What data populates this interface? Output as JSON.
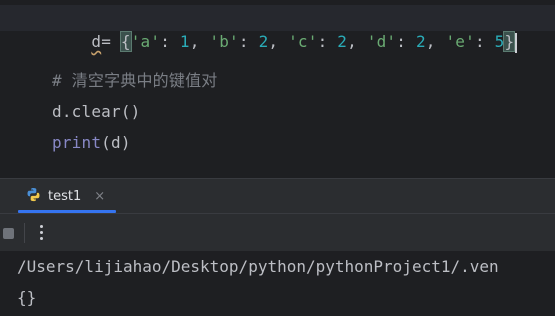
{
  "editor": {
    "line1": {
      "var": "d",
      "op": "= ",
      "open_brace": "{",
      "k1": "'a'",
      "v1": "1",
      "k2": "'b'",
      "v2": "2",
      "k3": "'c'",
      "v3": "2",
      "k4": "'d'",
      "v4": "2",
      "k5": "'e'",
      "v5": "5",
      "close_brace": "}",
      "colon": ": ",
      "comma": ", "
    },
    "comment": "# 清空字典中的键值对",
    "clear_call": "d.clear()",
    "print_fn": "print",
    "print_args": "(d)"
  },
  "run_panel": {
    "tab_label": "test1",
    "close_glyph": "×"
  },
  "console": {
    "path_line": "/Users/lijiahao/Desktop/python/pythonProject1/.ven",
    "output": "{}"
  },
  "colors": {
    "background": "#1e1f22",
    "panel": "#2b2d30",
    "string": "#6aab73",
    "number": "#2aacb8",
    "comment": "#7a7e85",
    "builtin": "#8888c6",
    "accent": "#3574f0"
  },
  "icons": {
    "run_config": "python-icon",
    "stop": "stop-icon",
    "more": "more-vertical-icon"
  }
}
